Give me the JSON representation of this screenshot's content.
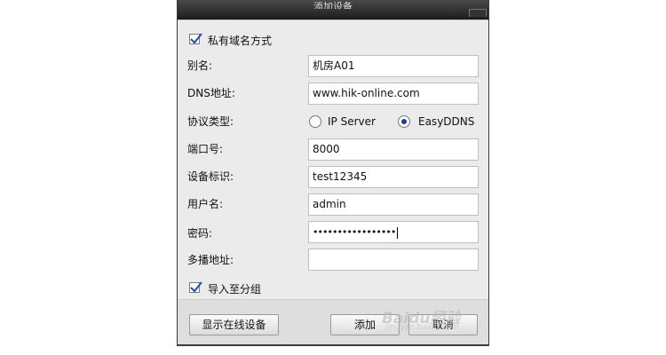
{
  "dialog": {
    "title": "添加设备",
    "private_domain": {
      "label": "私有域名方式",
      "checked": true
    },
    "fields": [
      {
        "label": "别名:",
        "value": "机房A01"
      },
      {
        "label": "DNS地址:",
        "value": "www.hik-online.com"
      },
      {
        "label": "端口号:",
        "value": "8000"
      },
      {
        "label": "设备标识:",
        "value": "test12345"
      },
      {
        "label": "用户名:",
        "value": "admin"
      },
      {
        "label": "密码:",
        "value": "•••••••••••••••••"
      },
      {
        "label": "多播地址:",
        "value": ""
      }
    ],
    "protocol": {
      "label": "协议类型:",
      "options": [
        "IP Server",
        "EasyDDNS"
      ],
      "selected": "EasyDDNS"
    },
    "import_group": {
      "label": "导入至分组",
      "checked": true
    },
    "buttons": {
      "show_online": "显示在线设备",
      "add": "添加",
      "cancel": "取消"
    }
  },
  "watermark": {
    "text": "Baidu经验",
    "sub": "jingyan.baidu.com"
  },
  "colors": {
    "radio_selected": "#1d3f91",
    "check_mark": "#2a4aa5",
    "dialog_bg": "#ebebeb"
  }
}
